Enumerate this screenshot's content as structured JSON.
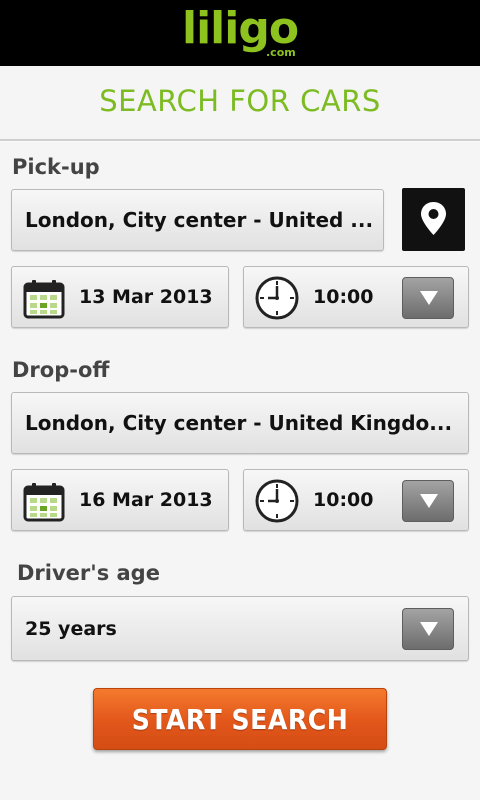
{
  "app": {
    "logo_text": "liligo",
    "logo_suffix": ".com",
    "brand_color": "#8dc21f"
  },
  "page": {
    "title": "SEARCH FOR CARS"
  },
  "pickup": {
    "label": "Pick-up",
    "location": "London, City center - United ...",
    "date": "13 Mar 2013",
    "time": "10:00"
  },
  "dropoff": {
    "label": "Drop-off",
    "location": "London, City center - United Kingdo...",
    "date": "16 Mar 2013",
    "time": "10:00"
  },
  "driver": {
    "label": "Driver's age",
    "selected": "25 years"
  },
  "action": {
    "start_label": "START SEARCH",
    "button_color": "#e8601f"
  },
  "icons": {
    "location": "location-pin-icon",
    "calendar": "calendar-icon",
    "clock": "clock-icon",
    "dropdown": "chevron-down-icon"
  }
}
